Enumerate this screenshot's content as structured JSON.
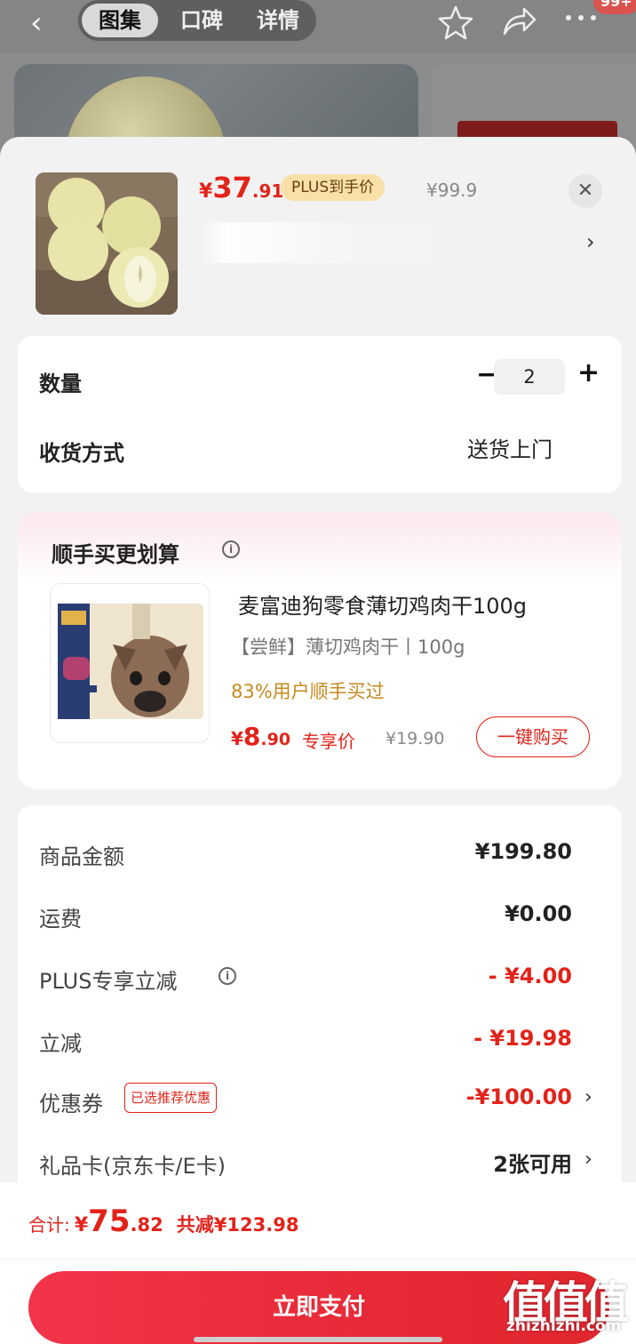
{
  "background_page": {
    "tabs": [
      "图集",
      "口碑",
      "详情"
    ],
    "active_tab": "图集",
    "notification_badge": "99+",
    "icons": [
      "back-arrow-icon",
      "star-icon",
      "share-icon",
      "more-icon"
    ]
  },
  "product": {
    "price_yen": "¥",
    "price_int": "37",
    "price_dec": ".91",
    "plus_tag": "PLUS到手价",
    "original_price": "¥99.9"
  },
  "options": {
    "quantity_label": "数量",
    "quantity_value": "2",
    "delivery_label": "收货方式",
    "delivery_value": "送货上门"
  },
  "addon": {
    "title": "顺手买更划算",
    "name": "麦富迪狗零食薄切鸡肉干100g",
    "spec": "【尝鲜】薄切鸡肉干丨100g",
    "bought": "83%用户顺手买过",
    "price_yen": "¥",
    "price_int": "8",
    "price_dec": ".90",
    "exclusive_label": "专享价",
    "original_price": "¥19.90",
    "buy_button": "一键购买"
  },
  "price_lines": [
    {
      "label": "商品金额",
      "value": "¥199.80"
    },
    {
      "label": "运费",
      "value": "¥0.00"
    },
    {
      "label": "PLUS专享立减",
      "value": "- ¥4.00"
    },
    {
      "label": "立减",
      "value": "- ¥19.98"
    },
    {
      "label": "优惠券",
      "tag": "已选推荐优惠",
      "value": "-¥100.00"
    },
    {
      "label": "礼品卡(京东卡/E卡)",
      "value": "2张可用"
    }
  ],
  "footer": {
    "total_label": "合计:",
    "total_yen": "¥",
    "total_int": "75",
    "total_dec": ".82",
    "saved_text": "共减¥123.98",
    "pay_button": "立即支付"
  },
  "watermark": {
    "logo": "值值值",
    "url": "zhizhizhi.com"
  },
  "colors": {
    "accent_red": "#e2231a",
    "plus_tag_bg": "#f8e0a8",
    "bought_text": "#c58a1c"
  }
}
